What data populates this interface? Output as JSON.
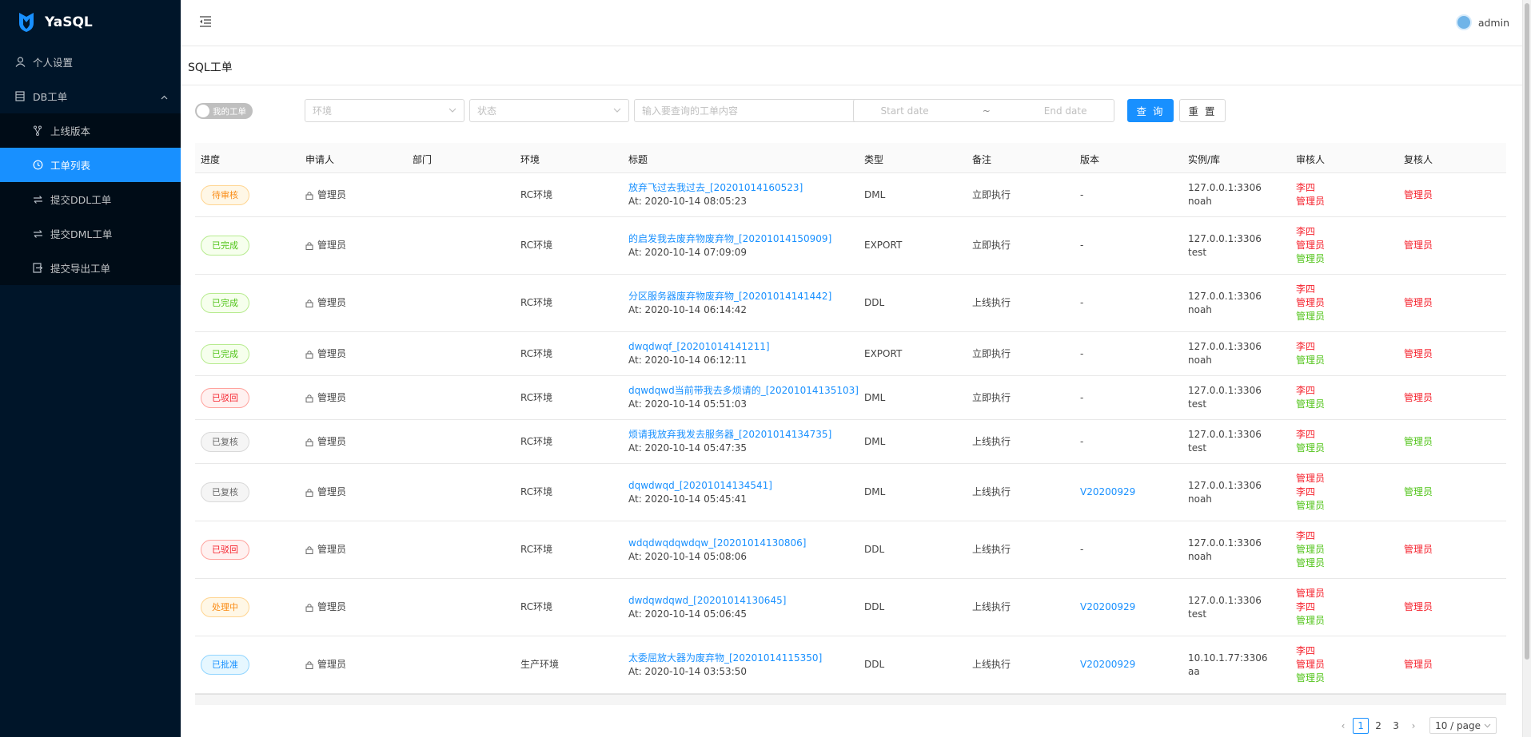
{
  "app": {
    "name": "YaSQL"
  },
  "sidebar": {
    "personal": "个人设置",
    "group": "DB工单",
    "items": [
      {
        "label": "上线版本",
        "icon": "branch-icon"
      },
      {
        "label": "工单列表",
        "icon": "clock-icon"
      },
      {
        "label": "提交DDL工单",
        "icon": "swap-icon"
      },
      {
        "label": "提交DML工单",
        "icon": "swap-icon"
      },
      {
        "label": "提交导出工单",
        "icon": "export-icon"
      }
    ],
    "active_index": 1
  },
  "header": {
    "user": "admin"
  },
  "page": {
    "title": "SQL工单"
  },
  "filters": {
    "my_orders": "我的工单",
    "env_placeholder": "环境",
    "status_placeholder": "状态",
    "search_placeholder": "输入要查询的工单内容",
    "start_date": "Start date",
    "tilde": "~",
    "end_date": "End date",
    "query": "查 询",
    "reset": "重 置"
  },
  "table": {
    "columns": [
      "进度",
      "申请人",
      "部门",
      "环境",
      "标题",
      "类型",
      "备注",
      "版本",
      "实例/库",
      "审核人",
      "复核人"
    ],
    "rows": [
      {
        "progress": "待审核",
        "tag": "orange",
        "applicant": "管理员",
        "env": "RC环境",
        "title": "放弃飞过去我过去_[20201014160523]",
        "at": "At: 2020-10-14 08:05:23",
        "type": "DML",
        "remark": "立即执行",
        "version": "-",
        "instance": "127.0.0.1:3306",
        "db": "noah",
        "auditors": [
          {
            "name": "李四",
            "c": "red"
          },
          {
            "name": "管理员",
            "c": "red"
          }
        ],
        "reviewers": [
          {
            "name": "管理员",
            "c": "red"
          }
        ]
      },
      {
        "progress": "已完成",
        "tag": "green",
        "applicant": "管理员",
        "env": "RC环境",
        "title": "的启发我去废弃物废弃物_[20201014150909]",
        "at": "At: 2020-10-14 07:09:09",
        "type": "EXPORT",
        "remark": "立即执行",
        "version": "-",
        "instance": "127.0.0.1:3306",
        "db": "test",
        "auditors": [
          {
            "name": "李四",
            "c": "red"
          },
          {
            "name": "管理员",
            "c": "red"
          },
          {
            "name": "管理员",
            "c": "green"
          }
        ],
        "reviewers": [
          {
            "name": "管理员",
            "c": "red"
          }
        ]
      },
      {
        "progress": "已完成",
        "tag": "green",
        "applicant": "管理员",
        "env": "RC环境",
        "title": "分区服务器废弃物废弃物_[20201014141442]",
        "at": "At: 2020-10-14 06:14:42",
        "type": "DDL",
        "remark": "上线执行",
        "version": "-",
        "instance": "127.0.0.1:3306",
        "db": "noah",
        "auditors": [
          {
            "name": "李四",
            "c": "red"
          },
          {
            "name": "管理员",
            "c": "red"
          },
          {
            "name": "管理员",
            "c": "green"
          }
        ],
        "reviewers": [
          {
            "name": "管理员",
            "c": "red"
          }
        ]
      },
      {
        "progress": "已完成",
        "tag": "green",
        "applicant": "管理员",
        "env": "RC环境",
        "title": "dwqdwqf_[20201014141211]",
        "at": "At: 2020-10-14 06:12:11",
        "type": "EXPORT",
        "remark": "立即执行",
        "version": "-",
        "instance": "127.0.0.1:3306",
        "db": "noah",
        "auditors": [
          {
            "name": "李四",
            "c": "red"
          },
          {
            "name": "管理员",
            "c": "green"
          }
        ],
        "reviewers": [
          {
            "name": "管理员",
            "c": "red"
          }
        ]
      },
      {
        "progress": "已驳回",
        "tag": "red",
        "applicant": "管理员",
        "env": "RC环境",
        "title": "dqwdqwd当前带我去多烦请的_[20201014135103]",
        "at": "At: 2020-10-14 05:51:03",
        "type": "DML",
        "remark": "立即执行",
        "version": "-",
        "instance": "127.0.0.1:3306",
        "db": "test",
        "auditors": [
          {
            "name": "李四",
            "c": "red"
          },
          {
            "name": "管理员",
            "c": "green"
          }
        ],
        "reviewers": [
          {
            "name": "管理员",
            "c": "red"
          }
        ]
      },
      {
        "progress": "已复核",
        "tag": "gray",
        "applicant": "管理员",
        "env": "RC环境",
        "title": "烦请我放弃我发去服务器_[20201014134735]",
        "at": "At: 2020-10-14 05:47:35",
        "type": "DML",
        "remark": "上线执行",
        "version": "-",
        "instance": "127.0.0.1:3306",
        "db": "test",
        "auditors": [
          {
            "name": "李四",
            "c": "red"
          },
          {
            "name": "管理员",
            "c": "green"
          }
        ],
        "reviewers": [
          {
            "name": "管理员",
            "c": "green"
          }
        ]
      },
      {
        "progress": "已复核",
        "tag": "gray",
        "applicant": "管理员",
        "env": "RC环境",
        "title": "dqwdwqd_[20201014134541]",
        "at": "At: 2020-10-14 05:45:41",
        "type": "DML",
        "remark": "上线执行",
        "version": "V20200929",
        "instance": "127.0.0.1:3306",
        "db": "noah",
        "auditors": [
          {
            "name": "管理员",
            "c": "red"
          },
          {
            "name": "李四",
            "c": "red"
          },
          {
            "name": "管理员",
            "c": "green"
          }
        ],
        "reviewers": [
          {
            "name": "管理员",
            "c": "green"
          }
        ]
      },
      {
        "progress": "已驳回",
        "tag": "red",
        "applicant": "管理员",
        "env": "RC环境",
        "title": "wdqdwqdqwdqw_[20201014130806]",
        "at": "At: 2020-10-14 05:08:06",
        "type": "DDL",
        "remark": "上线执行",
        "version": "-",
        "instance": "127.0.0.1:3306",
        "db": "noah",
        "auditors": [
          {
            "name": "李四",
            "c": "red"
          },
          {
            "name": "管理员",
            "c": "green"
          },
          {
            "name": "管理员",
            "c": "green"
          }
        ],
        "reviewers": [
          {
            "name": "管理员",
            "c": "red"
          }
        ]
      },
      {
        "progress": "处理中",
        "tag": "orange",
        "applicant": "管理员",
        "env": "RC环境",
        "title": "dwdqwdqwd_[20201014130645]",
        "at": "At: 2020-10-14 05:06:45",
        "type": "DDL",
        "remark": "上线执行",
        "version": "V20200929",
        "instance": "127.0.0.1:3306",
        "db": "test",
        "auditors": [
          {
            "name": "管理员",
            "c": "red"
          },
          {
            "name": "李四",
            "c": "red"
          },
          {
            "name": "管理员",
            "c": "green"
          }
        ],
        "reviewers": [
          {
            "name": "管理员",
            "c": "red"
          }
        ]
      },
      {
        "progress": "已批准",
        "tag": "blue",
        "applicant": "管理员",
        "env": "生产环境",
        "title": "太委屈放大器为废弃物_[20201014115350]",
        "at": "At: 2020-10-14 03:53:50",
        "type": "DDL",
        "remark": "上线执行",
        "version": "V20200929",
        "instance": "10.10.1.77:3306",
        "db": "aa",
        "auditors": [
          {
            "name": "李四",
            "c": "red"
          },
          {
            "name": "管理员",
            "c": "red"
          },
          {
            "name": "管理员",
            "c": "green"
          }
        ],
        "reviewers": [
          {
            "name": "管理员",
            "c": "red"
          }
        ]
      }
    ]
  },
  "pagination": {
    "prev": "‹",
    "pages": [
      "1",
      "2",
      "3"
    ],
    "current": "1",
    "next": "›",
    "size": "10 / page"
  }
}
